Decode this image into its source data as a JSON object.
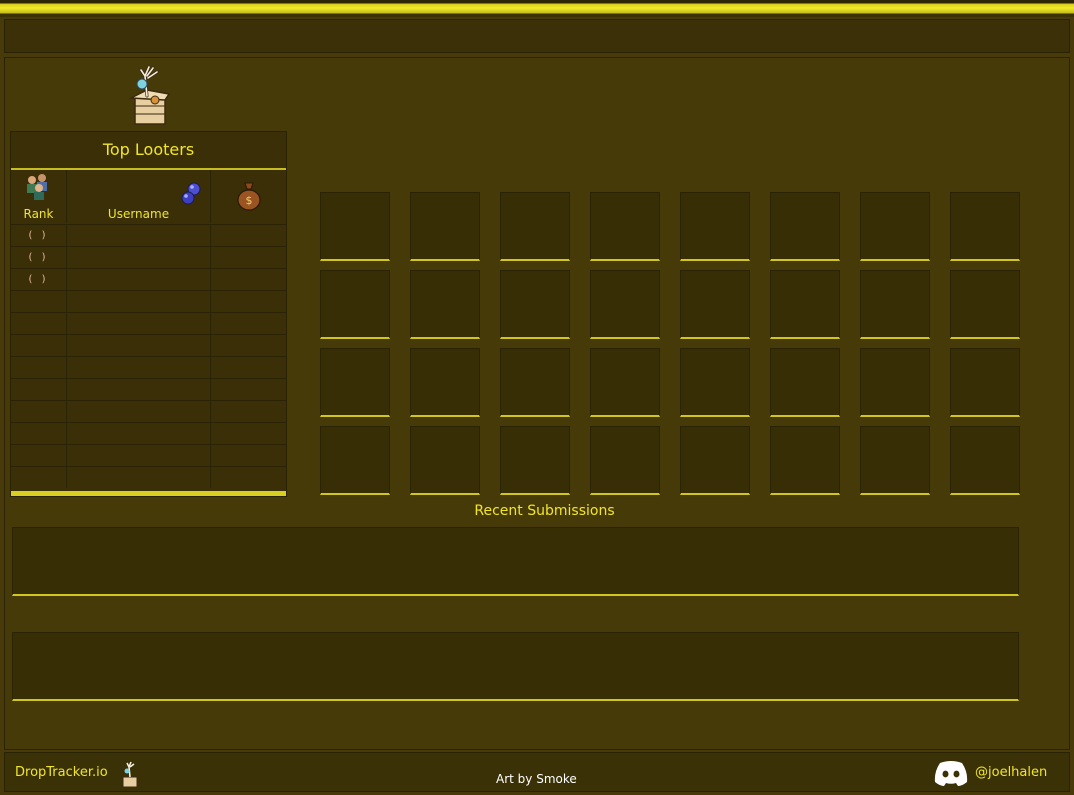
{
  "top_looters": {
    "title": "Top Looters",
    "columns": {
      "rank": "Rank",
      "username": "Username"
    },
    "rows": [
      {
        "rank": "( )"
      },
      {
        "rank": "( )"
      },
      {
        "rank": "( )"
      },
      {
        "rank": ""
      },
      {
        "rank": ""
      },
      {
        "rank": ""
      },
      {
        "rank": ""
      },
      {
        "rank": ""
      },
      {
        "rank": ""
      },
      {
        "rank": ""
      },
      {
        "rank": ""
      },
      {
        "rank": ""
      }
    ]
  },
  "grid": {
    "rows": 4,
    "cols": 8
  },
  "recent": {
    "title": "Recent Submissions"
  },
  "footer": {
    "brand": "DropTracker.io",
    "credit": "Art by Smoke",
    "handle": "@joelhalen"
  },
  "icons": {
    "logo": "loot-box-hand-icon",
    "rank_header": "players-icon",
    "username_header": "blue-orbs-icon",
    "value_header": "money-bag-icon",
    "brand": "loot-box-hand-icon",
    "social": "discord-icon"
  },
  "colors": {
    "background": "#483b09",
    "accent": "#f1e62a",
    "panel": "#382e05"
  }
}
